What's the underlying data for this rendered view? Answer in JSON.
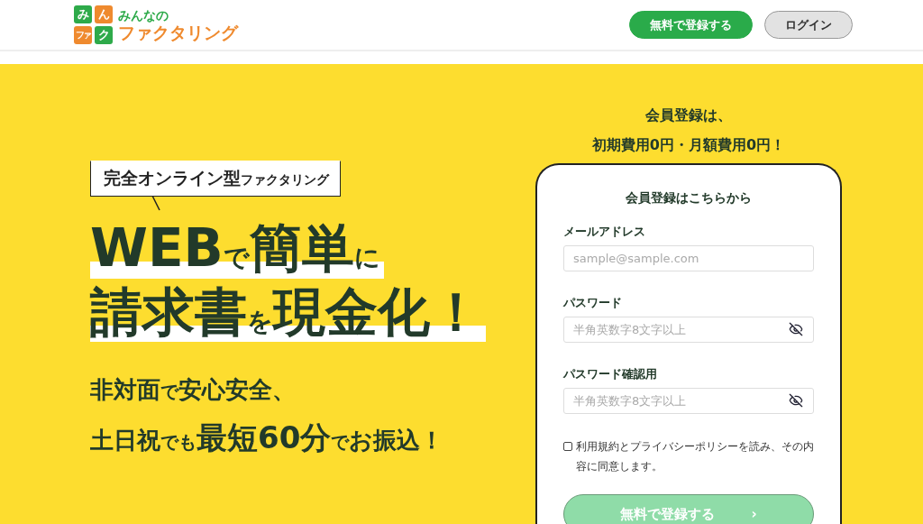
{
  "header": {
    "logo": {
      "tiles": [
        {
          "text": "み",
          "color": "#2eaa4a"
        },
        {
          "text": "ん",
          "color": "#ef8a2e"
        },
        {
          "text": "ファ",
          "color": "#ef8a2e"
        },
        {
          "text": "ク",
          "color": "#2eaa4a"
        }
      ],
      "top_text": "みんなの",
      "bottom_text": "ファクタリング"
    },
    "buttons": [
      {
        "label": "無料で登録する",
        "kind": "primary"
      },
      {
        "label": "ログイン",
        "kind": "secondary"
      }
    ]
  },
  "hero": {
    "badge": [
      {
        "text": "完全オンライン型",
        "kind": "word"
      },
      {
        "text": "ファクタリング",
        "kind": "particle"
      }
    ],
    "headline": [
      [
        {
          "text": "WEB",
          "kind": "word"
        },
        {
          "text": "で",
          "kind": "particle"
        },
        {
          "text": "簡単",
          "kind": "word"
        },
        {
          "text": "に",
          "kind": "particle"
        }
      ],
      [
        {
          "text": "請求書",
          "kind": "word"
        },
        {
          "text": "を",
          "kind": "particle"
        },
        {
          "text": "現金化！",
          "kind": "word"
        }
      ]
    ],
    "subtext": [
      [
        {
          "text": "非対面",
          "kind": "word"
        },
        {
          "text": "で",
          "kind": "particle"
        },
        {
          "text": "安心安全、",
          "kind": "word"
        }
      ],
      [
        {
          "text": "土日祝",
          "kind": "word"
        },
        {
          "text": "でも",
          "kind": "particle"
        },
        {
          "text": "最短60分",
          "kind": "highlight"
        },
        {
          "text": "で",
          "kind": "particle"
        },
        {
          "text": "お振込！",
          "kind": "word"
        }
      ]
    ]
  },
  "signup": {
    "intro": [
      "会員登録は、",
      "初期費用0円・月額費用0円！"
    ],
    "title": "会員登録はこちらから",
    "fields": [
      {
        "label": "メールアドレス",
        "placeholder": "sample@sample.com",
        "kind": "text"
      },
      {
        "label": "パスワード",
        "placeholder": "半角英数字8文字以上",
        "kind": "password"
      },
      {
        "label": "パスワード確認用",
        "placeholder": "半角英数字8文字以上",
        "kind": "password"
      }
    ],
    "agreement": {
      "text": "利用規約とプライバシーポリシーを読み、その内容に同意します。",
      "checked": false
    },
    "submit": {
      "label": "無料で登録する",
      "arrow": "›",
      "disabled": true
    }
  }
}
